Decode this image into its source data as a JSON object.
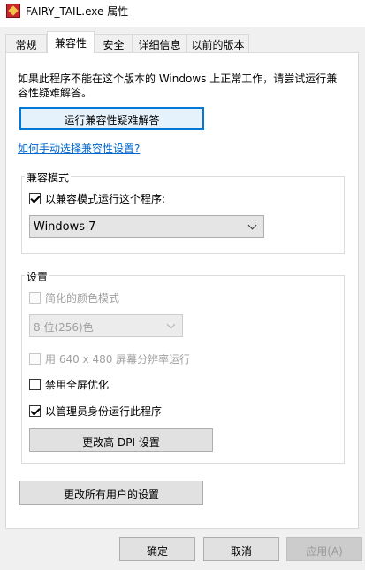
{
  "window": {
    "title": "FAIRY_TAIL.exe 属性",
    "icon": "app-icon"
  },
  "tabs": [
    {
      "label": "常规"
    },
    {
      "label": "兼容性",
      "active": true
    },
    {
      "label": "安全"
    },
    {
      "label": "详细信息"
    },
    {
      "label": "以前的版本"
    }
  ],
  "intro_line1": "如果此程序不能在这个版本的 Windows 上正常工作，请尝试运行兼",
  "intro_line2": "容性疑难解答。",
  "troubleshoot_button": "运行兼容性疑难解答",
  "manual_link": "如何手动选择兼容性设置?",
  "compat_mode": {
    "group_label": "兼容模式",
    "checkbox_label": "以兼容模式运行这个程序:",
    "checked": true,
    "selected_os": "Windows 7"
  },
  "settings": {
    "group_label": "设置",
    "reduced_color": {
      "label": "简化的颜色模式",
      "checked": false,
      "disabled": true
    },
    "color_select": {
      "value": "8 位(256)色",
      "disabled": true
    },
    "run_640": {
      "label": "用 640 x 480 屏幕分辨率运行",
      "checked": false,
      "disabled": true
    },
    "disable_fullscreen": {
      "label": "禁用全屏优化",
      "checked": false
    },
    "run_as_admin": {
      "label": "以管理员身份运行此程序",
      "checked": true
    },
    "dpi_button": "更改高 DPI 设置"
  },
  "all_users_button": "更改所有用户的设置",
  "footer": {
    "ok": "确定",
    "cancel": "取消",
    "apply": "应用(A)"
  }
}
